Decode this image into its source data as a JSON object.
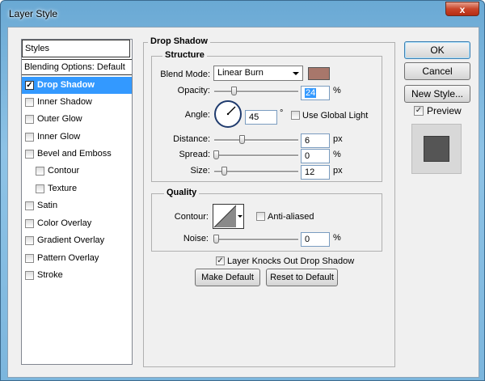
{
  "window": {
    "title": "Layer Style",
    "close_glyph": "x"
  },
  "styles_list": {
    "header": "Styles",
    "blending_options": "Blending Options: Default",
    "items": [
      {
        "label": "Drop Shadow",
        "checked": true,
        "selected": true
      },
      {
        "label": "Inner Shadow",
        "checked": false
      },
      {
        "label": "Outer Glow",
        "checked": false
      },
      {
        "label": "Inner Glow",
        "checked": false
      },
      {
        "label": "Bevel and Emboss",
        "checked": false
      },
      {
        "label": "Contour",
        "checked": false,
        "sub": true
      },
      {
        "label": "Texture",
        "checked": false,
        "sub": true
      },
      {
        "label": "Satin",
        "checked": false
      },
      {
        "label": "Color Overlay",
        "checked": false
      },
      {
        "label": "Gradient Overlay",
        "checked": false
      },
      {
        "label": "Pattern Overlay",
        "checked": false
      },
      {
        "label": "Stroke",
        "checked": false
      }
    ]
  },
  "drop_shadow": {
    "title": "Drop Shadow",
    "structure": {
      "title": "Structure",
      "blend_mode_label": "Blend Mode:",
      "blend_mode_value": "Linear Burn",
      "shadow_color": "#a8776b",
      "opacity_label": "Opacity:",
      "opacity_value": "24",
      "opacity_unit": "%",
      "angle_label": "Angle:",
      "angle_value": "45",
      "angle_unit": "°",
      "use_global_light_label": "Use Global Light",
      "use_global_light_checked": false,
      "distance_label": "Distance:",
      "distance_value": "6",
      "distance_unit": "px",
      "spread_label": "Spread:",
      "spread_value": "0",
      "spread_unit": "%",
      "size_label": "Size:",
      "size_value": "12",
      "size_unit": "px"
    },
    "quality": {
      "title": "Quality",
      "contour_label": "Contour:",
      "anti_aliased_label": "Anti-aliased",
      "anti_aliased_checked": false,
      "noise_label": "Noise:",
      "noise_value": "0",
      "noise_unit": "%"
    },
    "knocks_out_label": "Layer Knocks Out Drop Shadow",
    "knocks_out_checked": true,
    "make_default_label": "Make Default",
    "reset_default_label": "Reset to Default"
  },
  "actions": {
    "ok_label": "OK",
    "cancel_label": "Cancel",
    "new_style_label": "New Style...",
    "preview_label": "Preview",
    "preview_checked": true
  },
  "check_glyph": "✓"
}
